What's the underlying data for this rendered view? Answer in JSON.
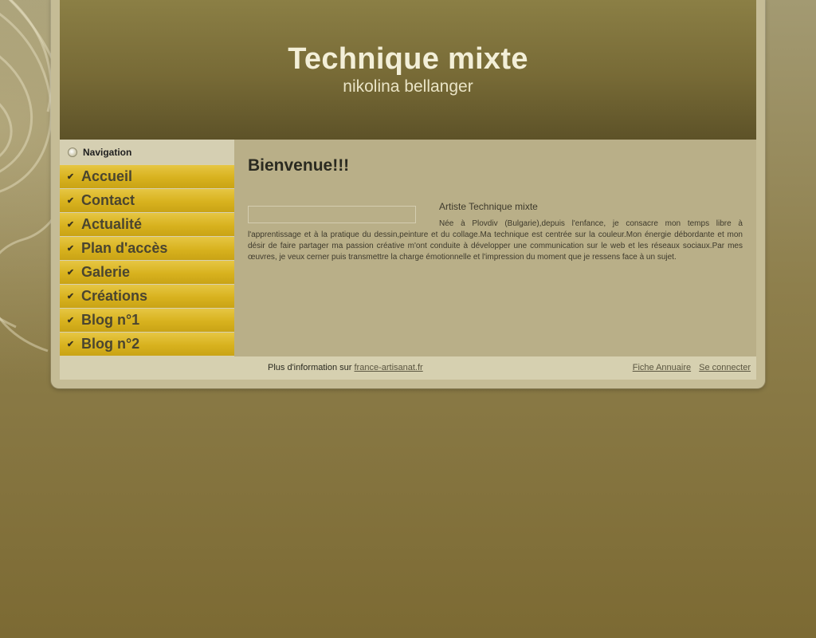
{
  "header": {
    "title": "Technique mixte",
    "subtitle": "nikolina bellanger"
  },
  "sidebar": {
    "heading": "Navigation",
    "items": [
      {
        "label": "Accueil"
      },
      {
        "label": "Contact"
      },
      {
        "label": "Actualité"
      },
      {
        "label": "Plan d'accès"
      },
      {
        "label": "Galerie"
      },
      {
        "label": "Créations"
      },
      {
        "label": "Blog n°1"
      },
      {
        "label": "Blog n°2"
      }
    ]
  },
  "main": {
    "heading": "Bienvenue!!!",
    "intro_title": "Artiste Technique mixte",
    "intro_text": "Née à Plovdiv (Bulgarie),depuis l'enfance, je consacre mon temps libre à l'apprentissage et à la pratique du dessin,peinture et du collage.Ma technique est centrée sur la couleur.Mon énergie débordante et mon désir de faire partager ma passion créative m'ont conduite à développer une communication sur le web et les réseaux sociaux.Par mes œuvres, je veux cerner puis transmettre la charge émotionnelle et l'impression du moment que je ressens face à un sujet."
  },
  "footer": {
    "info_prefix": "Plus d'information sur",
    "info_link": "france-artisanat.fr",
    "directory_link": "Fiche Annuaire",
    "login_link": "Se connecter"
  },
  "colors": {
    "nav_item": "#d8b21e",
    "header": "#776a36",
    "content_bg": "#b9af88"
  }
}
